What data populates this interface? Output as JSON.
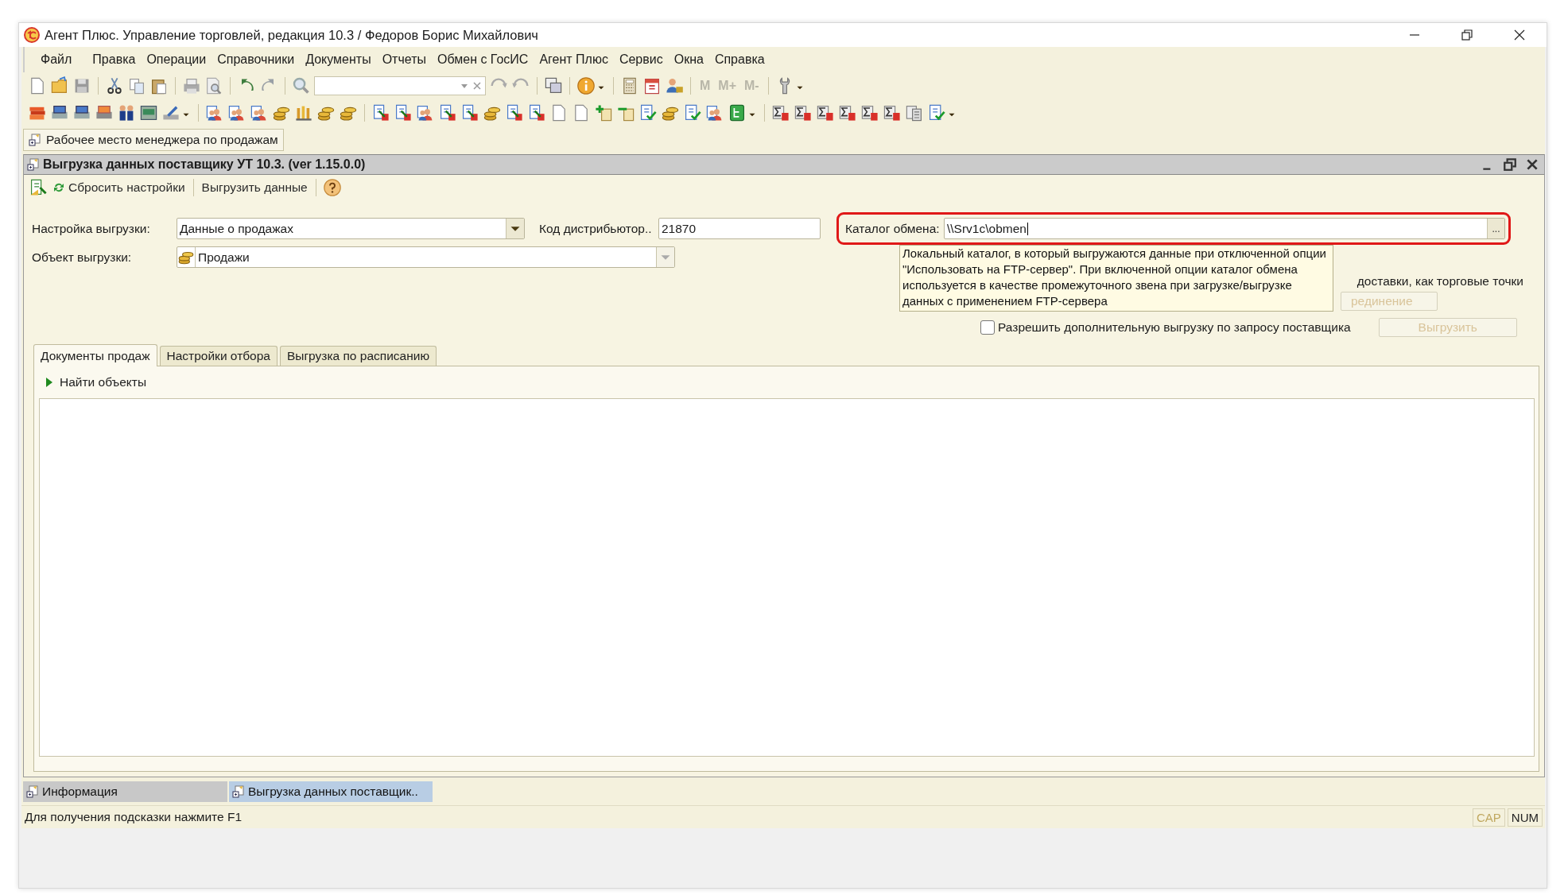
{
  "window": {
    "title": "Агент Плюс. Управление торговлей, редакция 10.3 / Федоров Борис Михайлович"
  },
  "menu": [
    {
      "label": "Файл"
    },
    {
      "label": "Правка"
    },
    {
      "label": "Операции"
    },
    {
      "label": "Справочники"
    },
    {
      "label": "Документы"
    },
    {
      "label": "Отчеты"
    },
    {
      "label": "Обмен с ГосИС"
    },
    {
      "label": "Агент Плюс"
    },
    {
      "label": "Сервис"
    },
    {
      "label": "Окна"
    },
    {
      "label": "Справка"
    }
  ],
  "memory_buttons": [
    {
      "label": "M",
      "disabled": true
    },
    {
      "label": "M+",
      "disabled": true
    },
    {
      "label": "M-",
      "disabled": true
    }
  ],
  "panel_button": {
    "label": "Рабочее место менеджера по продажам"
  },
  "child_window": {
    "title": "Выгрузка данных поставщику УТ 10.3. (ver 1.15.0.0)"
  },
  "form_toolbar": [
    {
      "label": "Сбросить настройки"
    },
    {
      "label": "Выгрузить данные"
    }
  ],
  "settings": {
    "label": "Настройка выгрузки:",
    "value": "Данные о продажах"
  },
  "distributor_code": {
    "label": "Код дистрибьютор..",
    "value": "21870"
  },
  "exchange_dir": {
    "label": "Каталог обмена:",
    "value": "\\\\Srv1c\\obmen",
    "select_button": "...",
    "highlighted": true
  },
  "object": {
    "label": "Объект выгрузки:",
    "value": "Продажи"
  },
  "tooltip": {
    "text": "Локальный каталог, в который выгружаются данные при отключенной опции \"Использовать на FTP-сервер\". При включенной опции каталог обмена используется в качестве промежуточного звена при загрузке/выгрузке данных с применением FTP-сервера"
  },
  "partial_line": "доставки, как торговые точки",
  "connect_button": {
    "label": "рединение",
    "disabled": true
  },
  "allow_extra": {
    "label": "Разрешить дополнительную выгрузку по запросу поставщика",
    "checked": false
  },
  "export_button": {
    "label": "Выгрузить",
    "disabled": true
  },
  "tabs": [
    {
      "label": "Документы продаж",
      "selected": true
    },
    {
      "label": "Настройки отбора",
      "selected": false
    },
    {
      "label": "Выгрузка по расписанию",
      "selected": false
    }
  ],
  "find_objects": {
    "label": "Найти объекты"
  },
  "window_tabs": [
    {
      "label": "Информация",
      "selected": false
    },
    {
      "label": "Выгрузка данных поставщик..",
      "selected": true
    }
  ],
  "status_bar": {
    "text": "Для получения подсказки нажмите F1",
    "indicators": [
      {
        "label": "CAP",
        "on": false
      },
      {
        "label": "NUM",
        "on": true
      }
    ]
  }
}
